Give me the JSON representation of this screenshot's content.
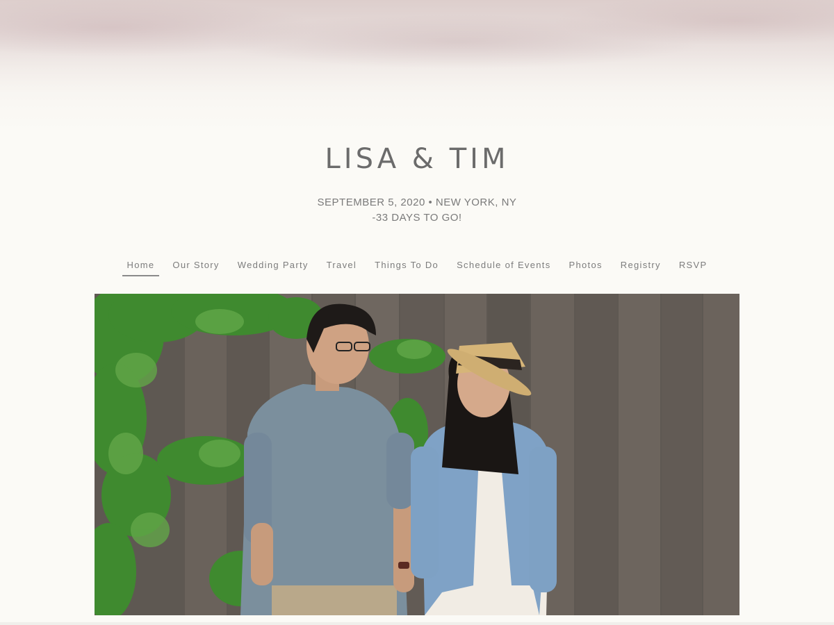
{
  "header": {
    "title": "LISA & TIM",
    "date_location": "SEPTEMBER 5, 2020 • NEW YORK, NY",
    "countdown": "-33 DAYS TO GO!"
  },
  "nav": {
    "items": [
      {
        "label": "Home",
        "active": true
      },
      {
        "label": "Our Story"
      },
      {
        "label": "Wedding Party"
      },
      {
        "label": "Travel"
      },
      {
        "label": "Things To Do"
      },
      {
        "label": "Schedule of Events"
      },
      {
        "label": "Photos"
      },
      {
        "label": "Registry"
      },
      {
        "label": "RSVP"
      }
    ]
  },
  "hero": {
    "image": "couple-photo",
    "colors": {
      "fence": "#6d655e",
      "ivy": "#3f8a2f",
      "shirt": "#7b8f9d",
      "jacket": "#7fa2c6"
    }
  },
  "theme": {
    "background": "#fbfaf6",
    "accent": "#c9b3b5",
    "text": "#6b6b6b"
  }
}
